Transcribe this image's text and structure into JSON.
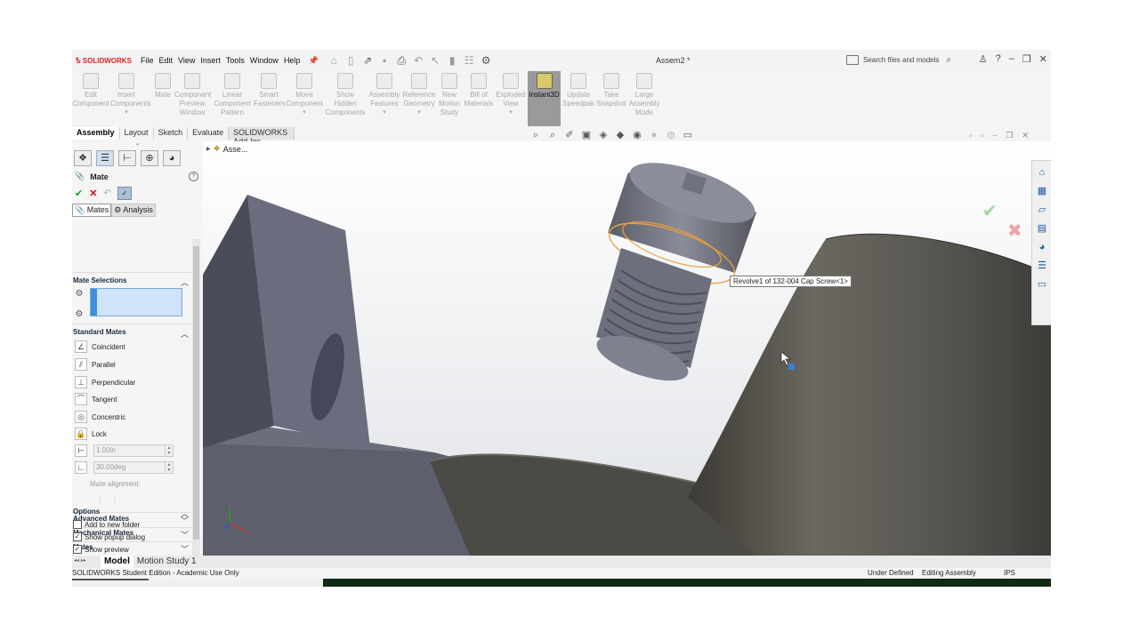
{
  "app": {
    "logo_text": "SOLIDWORKS",
    "document_title": "Assem2 *",
    "menu": [
      "File",
      "Edit",
      "View",
      "Insert",
      "Tools",
      "Window",
      "Help"
    ],
    "search_placeholder": "Search files and models"
  },
  "ribbon": {
    "tools": [
      {
        "label": "Edit Component"
      },
      {
        "label": "Insert Components"
      },
      {
        "label": "Mate"
      },
      {
        "label": "Component Preview Window"
      },
      {
        "label": "Linear Component Pattern"
      },
      {
        "label": "Smart Fasteners"
      },
      {
        "label": "Move Component"
      },
      {
        "label": "Show Hidden Components"
      },
      {
        "label": "Assembly Features"
      },
      {
        "label": "Reference Geometry"
      },
      {
        "label": "New Motion Study"
      },
      {
        "label": "Bill of Materials"
      },
      {
        "label": "Exploded View"
      },
      {
        "label": "Instant3D"
      },
      {
        "label": "Update Speedpak"
      },
      {
        "label": "Take Snapshot"
      },
      {
        "label": "Large Assembly Mode"
      }
    ]
  },
  "command_tabs": [
    "Assembly",
    "Layout",
    "Sketch",
    "Evaluate",
    "SOLIDWORKS Add-Ins"
  ],
  "property_manager": {
    "title": "Mate",
    "subtabs": [
      "Mates",
      "Analysis"
    ],
    "sections": {
      "mate_selections": "Mate Selections",
      "standard_mates": "Standard Mates",
      "advanced_mates": "Advanced Mates",
      "mechanical_mates": "Mechanical Mates",
      "mates": "Mates",
      "options": "Options"
    },
    "standard_mates": [
      "Coincident",
      "Parallel",
      "Perpendicular",
      "Tangent",
      "Concentric",
      "Lock"
    ],
    "distance_value": "1.00in",
    "angle_value": "30.00deg",
    "mate_alignment_label": "Mate alignment:",
    "options": [
      {
        "label": "Add to new folder",
        "checked": false
      },
      {
        "label": "Show popup dialog",
        "checked": true
      },
      {
        "label": "Show preview",
        "checked": true
      }
    ]
  },
  "graphics": {
    "tree_root": "Asse...",
    "tooltip": "Revolve1 of 132-004 Cap Screw<1>"
  },
  "bottom_tabs": [
    "Model",
    "Motion Study 1"
  ],
  "status": {
    "edition": "SOLIDWORKS Student Edition - Academic Use Only",
    "state": "Under Defined",
    "mode": "Editing Assembly",
    "units": "IPS"
  },
  "colors": {
    "logo_red": "#d22222",
    "selection_fill": "#cfe3f9",
    "selection_bar": "#3f8fe0",
    "active_tool": "#9a9a9a",
    "ok_green": "#1c9a1c",
    "cancel_red": "#cc1010",
    "edge_highlight": "#e8a040"
  }
}
